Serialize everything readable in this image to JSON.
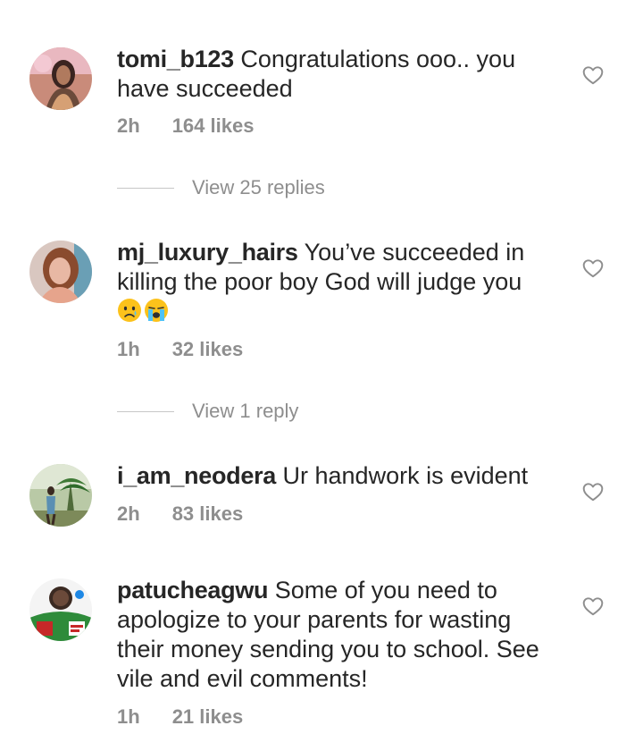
{
  "comments": [
    {
      "username": "tomi_b123",
      "text": "Congratulations ooo.. you have succeeded",
      "time": "2h",
      "likes": "164 likes",
      "replies": "View 25 replies"
    },
    {
      "username": "mj_luxury_hairs",
      "text": "You’ve succeeded in killing the poor boy God will judge you",
      "emojis": [
        "crying-face",
        "loudly-crying-face"
      ],
      "time": "1h",
      "likes": "32 likes",
      "replies": "View 1 reply"
    },
    {
      "username": "i_am_neodera",
      "text": "Ur handwork is evident",
      "time": "2h",
      "likes": "83 likes"
    },
    {
      "username": "patucheagwu",
      "text": "Some of you need to apologize to your parents for wasting their money sending you to school. See vile and evil comments!",
      "time": "1h",
      "likes": "21 likes"
    }
  ],
  "icons": {
    "like": "heart-outline-icon"
  },
  "colors": {
    "meta": "#8e8e8e",
    "text": "#262626",
    "divider": "#c7c7c7"
  }
}
